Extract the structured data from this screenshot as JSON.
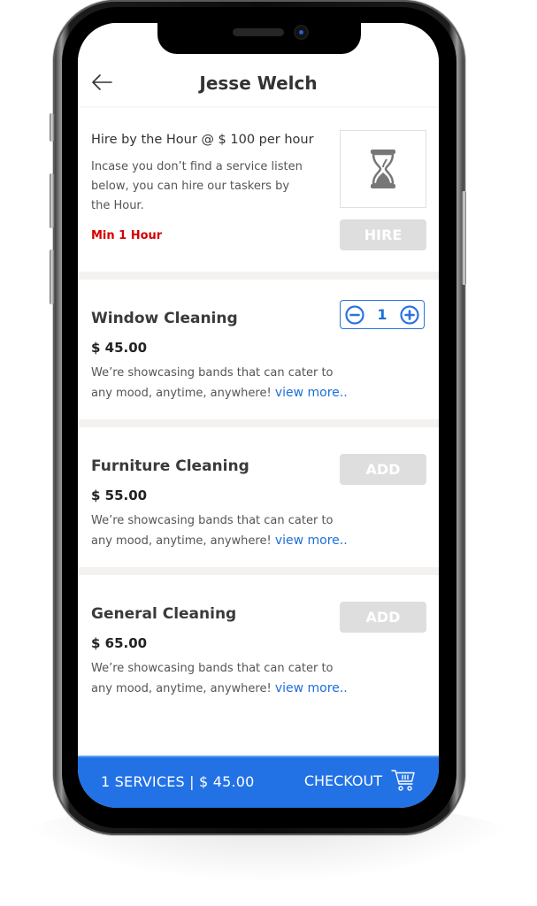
{
  "header": {
    "title": "Jesse Welch",
    "back_icon": "arrow-left-icon"
  },
  "hire_by_hour": {
    "title": "Hire by the Hour @ $ 100 per hour",
    "description": "Incase you don’t find a service listen below, you can hire our taskers by the Hour.",
    "min_label": "Min 1 Hour",
    "icon": "hourglass-icon",
    "button_label": "HIRE"
  },
  "services": [
    {
      "name": "Window Cleaning",
      "price": "$ 45.00",
      "description": "We’re showcasing bands that can cater to any mood, anytime, anywhere! ",
      "link_label": "view more..",
      "control": "stepper",
      "quantity": "1"
    },
    {
      "name": "Furniture Cleaning",
      "price": "$ 55.00",
      "description": "We’re showcasing bands that can cater to any mood, anytime, anywhere! ",
      "link_label": "view more..",
      "control": "add",
      "button_label": "ADD"
    },
    {
      "name": "General Cleaning",
      "price": "$ 65.00",
      "description": "We’re showcasing bands that can cater to any mood, anytime, anywhere! ",
      "link_label": "view more..",
      "control": "add",
      "button_label": "ADD"
    }
  ],
  "footer": {
    "summary": "1  SERVICES | $ 45.00",
    "checkout_label": "CHECKOUT",
    "cart_icon": "cart-icon"
  },
  "colors": {
    "accent": "#2272e6",
    "link": "#1e6fd9",
    "warning": "#d60000",
    "disabled_button": "#dedede",
    "divider": "#f3f2f0"
  }
}
